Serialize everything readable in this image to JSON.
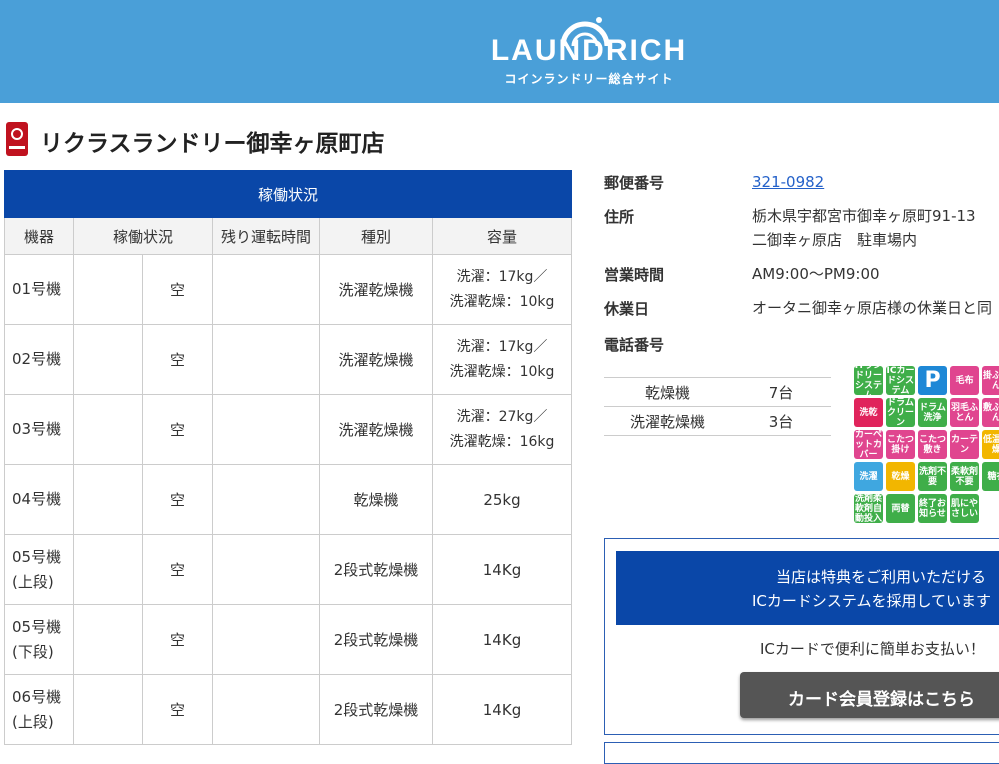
{
  "header": {
    "logo_text": "LAUNDRICH",
    "logo_sub": "コインランドリー総合サイト",
    "color": "#4a9fd8"
  },
  "store": {
    "name": "リクラスランドリー御幸ヶ原町店",
    "icon": "store-marker-icon"
  },
  "status_table": {
    "caption": "稼働状況",
    "headers": [
      "機器",
      "稼働状況",
      "残り運転時間",
      "種別",
      "容量"
    ],
    "rows": [
      {
        "machine": "01号機",
        "status": "空",
        "remaining": "",
        "type": "洗濯乾燥機",
        "cap1": "洗濯：17kg／",
        "cap2": "洗濯乾燥：10kg"
      },
      {
        "machine": "02号機",
        "status": "空",
        "remaining": "",
        "type": "洗濯乾燥機",
        "cap1": "洗濯：17kg／",
        "cap2": "洗濯乾燥：10kg"
      },
      {
        "machine": "03号機",
        "status": "空",
        "remaining": "",
        "type": "洗濯乾燥機",
        "cap1": "洗濯：27kg／",
        "cap2": "洗濯乾燥：16kg"
      },
      {
        "machine": "04号機",
        "status": "空",
        "remaining": "",
        "type": "乾燥機",
        "cap1": "25kg",
        "cap2": ""
      },
      {
        "machine": "05号機",
        "machine2": "(上段)",
        "status": "空",
        "remaining": "",
        "type": "2段式乾燥機",
        "cap1": "14Kg",
        "cap2": ""
      },
      {
        "machine": "05号機",
        "machine2": "(下段)",
        "status": "空",
        "remaining": "",
        "type": "2段式乾燥機",
        "cap1": "14Kg",
        "cap2": ""
      },
      {
        "machine": "06号機",
        "machine2": "(上段)",
        "status": "空",
        "remaining": "",
        "type": "2段式乾燥機",
        "cap1": "14Kg",
        "cap2": ""
      }
    ]
  },
  "info": {
    "postal_label": "郵便番号",
    "postal_value": "321-0982",
    "address_label": "住所",
    "address_line1": "栃木県宇都宮市御幸ヶ原町91-13",
    "address_line2": "二御幸ヶ原店　駐車場内",
    "hours_label": "営業時間",
    "hours_value": "AM9:00〜PM9:00",
    "holiday_label": "休業日",
    "holiday_value": "オータニ御幸ヶ原店様の休業日と同",
    "phone_label": "電話番号",
    "phone_value": ""
  },
  "machines": [
    {
      "name": "乾燥機",
      "count": "7台"
    },
    {
      "name": "洗濯乾燥機",
      "count": "3台"
    }
  ],
  "badges": [
    {
      "text": "ITランドリーシステム",
      "color": "#3fae49"
    },
    {
      "text": "ICカードシステム",
      "color": "#3fae49"
    },
    {
      "text": "P",
      "color": "#1e88d6"
    },
    {
      "text": "毛布",
      "color": "#e0458f"
    },
    {
      "text": "掛ふとん",
      "color": "#e0458f"
    },
    {
      "text": "洗乾",
      "color": "#e0245c"
    },
    {
      "text": "ドラムクリーン",
      "color": "#3fae49"
    },
    {
      "text": "ドラム洗浄",
      "color": "#3fae49"
    },
    {
      "text": "羽毛ふとん",
      "color": "#e0458f"
    },
    {
      "text": "敷ふとん",
      "color": "#e0458f"
    },
    {
      "text": "カーペットカバー",
      "color": "#e0458f"
    },
    {
      "text": "こたつ掛け",
      "color": "#e0458f"
    },
    {
      "text": "こたつ敷き",
      "color": "#e0458f"
    },
    {
      "text": "カーテン",
      "color": "#e0458f"
    },
    {
      "text": "低温乾燥",
      "color": "#f2b600"
    },
    {
      "text": "洗濯",
      "color": "#3fa7e0"
    },
    {
      "text": "乾燥",
      "color": "#f2b600"
    },
    {
      "text": "洗剤不要",
      "color": "#3fae49"
    },
    {
      "text": "柔軟剤不要",
      "color": "#3fae49"
    },
    {
      "text": "糖衣",
      "color": "#3fae49"
    },
    {
      "text": "洗剤柔軟剤自動投入",
      "color": "#3fae49"
    },
    {
      "text": "両替",
      "color": "#3fae49"
    },
    {
      "text": "終了お知らせ",
      "color": "#3fae49"
    },
    {
      "text": "肌にやさしい",
      "color": "#3fae49"
    }
  ],
  "ic": {
    "line1": "当店は特典をご利用いただける",
    "line2": "ICカードシステムを採用しています",
    "note": "ICカードで便利に簡単お支払い！",
    "button": "カード会員登録はこちら"
  }
}
